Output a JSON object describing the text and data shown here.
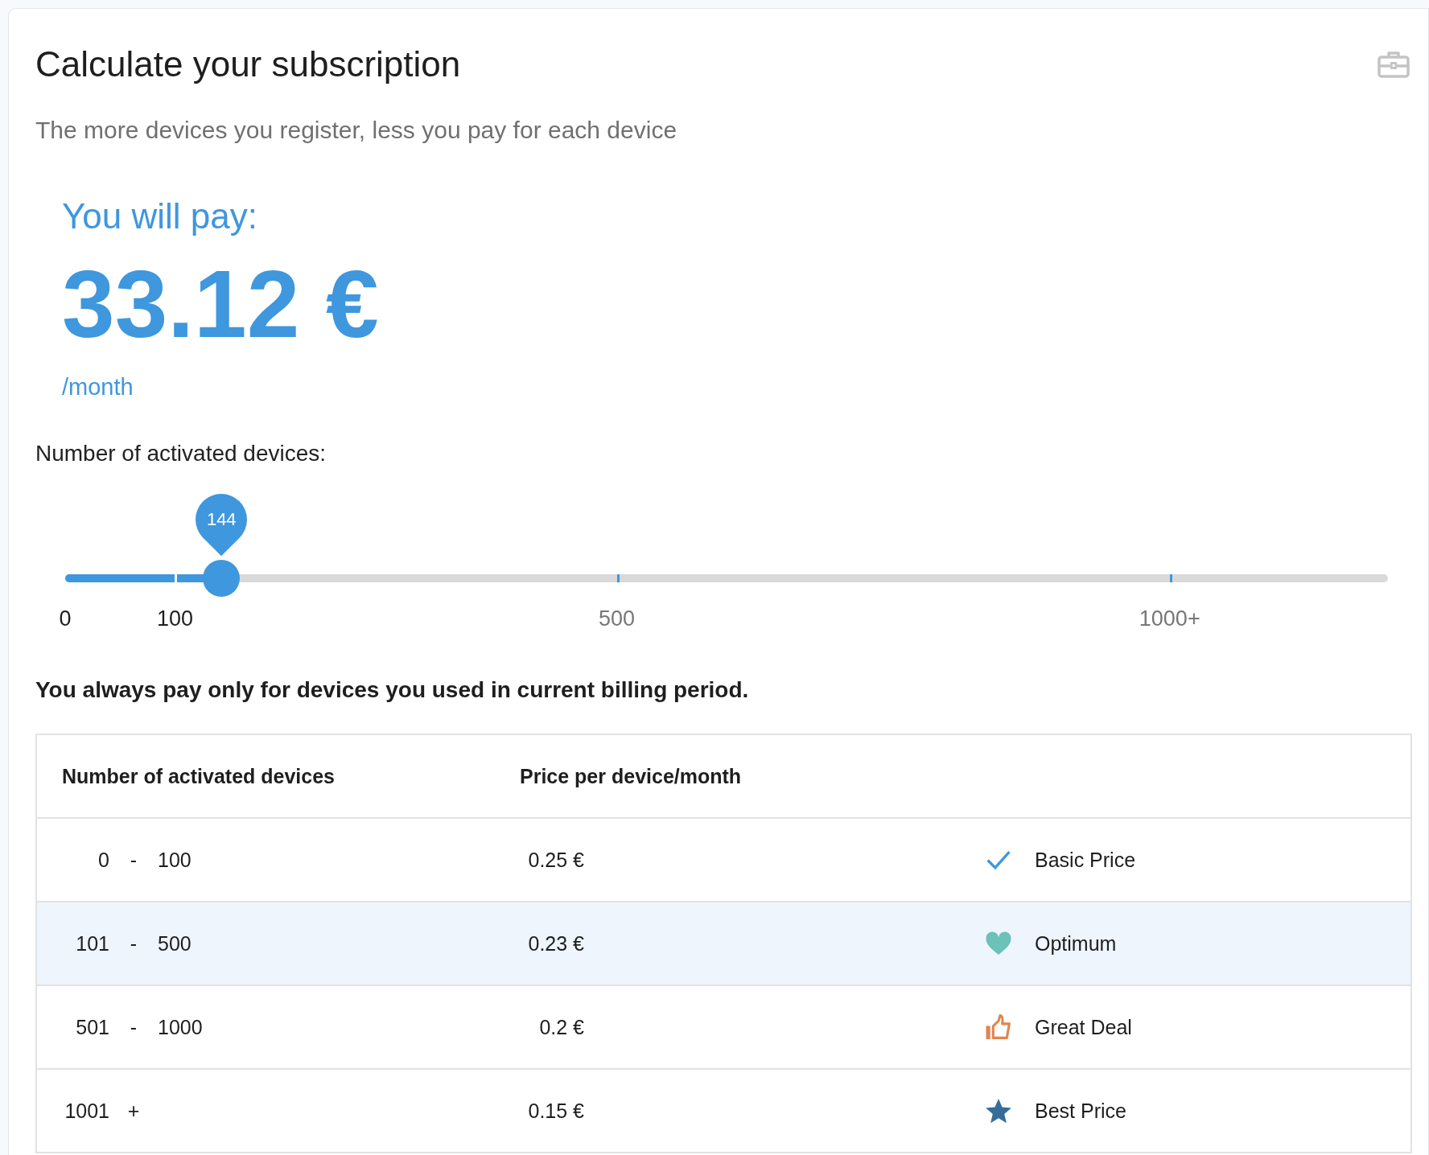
{
  "card": {
    "title": "Calculate your subscription",
    "subtitle": "The more devices you register, less you pay for each device"
  },
  "summary": {
    "label": "You will pay:",
    "amount": "33.12 €",
    "period": "/month"
  },
  "slider": {
    "label": "Number of activated devices:",
    "value": "144",
    "level": 0.118,
    "ticks": [
      {
        "label": "0",
        "reached": true
      },
      {
        "label": "100",
        "reached": true
      },
      {
        "label": "500",
        "reached": false
      },
      {
        "label": "1000+",
        "reached": false
      }
    ]
  },
  "note": "You always pay only for devices you used in current billing period.",
  "table": {
    "columns": [
      "Number of activated devices",
      "Price per device/month"
    ],
    "rows": [
      {
        "range": [
          "0",
          "-",
          "100"
        ],
        "price": "0.25 €",
        "tier": "Basic Price",
        "kind": "check",
        "color": "#3f97dd",
        "selected": false
      },
      {
        "range": [
          "101",
          "-",
          "500"
        ],
        "price": "0.23 €",
        "tier": "Optimum",
        "kind": "heart",
        "color": "#6cc1b8",
        "selected": true
      },
      {
        "range": [
          "501",
          "-",
          "1000"
        ],
        "price": "0.2 €",
        "tier": "Great Deal",
        "kind": "thumb",
        "color": "#e2844f",
        "selected": false
      },
      {
        "range": [
          "1001",
          "+"
        ],
        "price": "0.15 €",
        "tier": "Best Price",
        "kind": "star",
        "color": "#356d98",
        "selected": false
      }
    ]
  }
}
